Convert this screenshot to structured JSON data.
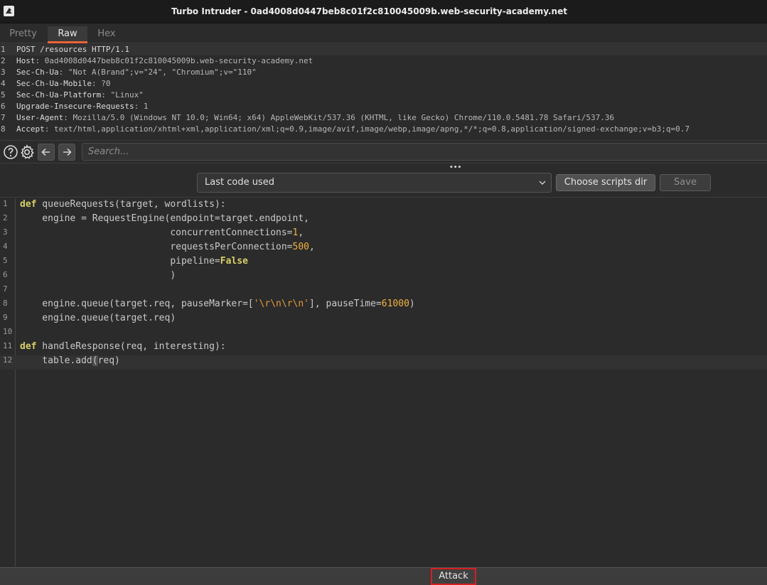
{
  "window": {
    "title": "Turbo Intruder - 0ad4008d0447beb8c01f2c810045009b.web-security-academy.net"
  },
  "tabs": [
    {
      "label": "Pretty"
    },
    {
      "label": "Raw"
    },
    {
      "label": "Hex"
    }
  ],
  "request": {
    "lines": [
      {
        "num": "1",
        "key": "POST /resources HTTP/1.1",
        "value": ""
      },
      {
        "num": "2",
        "key": "Host",
        "value": ": 0ad4008d0447beb8c01f2c810045009b.web-security-academy.net"
      },
      {
        "num": "3",
        "key": "Sec-Ch-Ua",
        "value": ": \"Not A(Brand\";v=\"24\", \"Chromium\";v=\"110\""
      },
      {
        "num": "4",
        "key": "Sec-Ch-Ua-Mobile",
        "value": ": ?0"
      },
      {
        "num": "5",
        "key": "Sec-Ch-Ua-Platform",
        "value": ": \"Linux\""
      },
      {
        "num": "6",
        "key": "Upgrade-Insecure-Requests",
        "value": ": 1"
      },
      {
        "num": "7",
        "key": "User-Agent",
        "value": ": Mozilla/5.0 (Windows NT 10.0; Win64; x64) AppleWebKit/537.36 (KHTML, like Gecko) Chrome/110.0.5481.78 Safari/537.36"
      },
      {
        "num": "8",
        "key": "Accept",
        "value": ": text/html,application/xhtml+xml,application/xml;q=0.9,image/avif,image/webp,image/apng,*/*;q=0.8,application/signed-exchange;v=b3;q=0.7"
      }
    ]
  },
  "search": {
    "placeholder": "Search..."
  },
  "divider": {
    "dots": "•••"
  },
  "script": {
    "selected": "Last code used",
    "choose_label": "Choose scripts dir",
    "save_label": "Save"
  },
  "code": {
    "line_numbers": [
      "1",
      "2",
      "3",
      "4",
      "5",
      "6",
      "7",
      "8",
      "9",
      "10",
      "11",
      "12"
    ]
  },
  "attack": {
    "label": "Attack"
  },
  "colors": {
    "accent": "#e8643a",
    "attack_border": "#d61f1f",
    "keyword": "#d6d069",
    "number": "#f2b33d"
  }
}
